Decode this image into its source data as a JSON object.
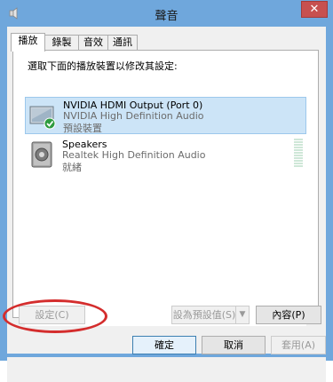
{
  "window": {
    "title": "聲音",
    "close_glyph": "✕"
  },
  "tabs": [
    {
      "label": "播放",
      "active": true
    },
    {
      "label": "錄製",
      "active": false
    },
    {
      "label": "音效",
      "active": false
    },
    {
      "label": "通訊",
      "active": false
    }
  ],
  "instruction": "選取下面的播放裝置以修改其設定:",
  "devices": [
    {
      "name": "NVIDIA HDMI Output (Port 0)",
      "driver": "NVIDIA High Definition Audio",
      "status": "預設裝置",
      "selected": true,
      "icon": "monitor-icon"
    },
    {
      "name": "Speakers",
      "driver": "Realtek High Definition Audio",
      "status": "就緒",
      "selected": false,
      "icon": "speaker-icon"
    }
  ],
  "buttons": {
    "configure": "設定(C)",
    "set_default": "設為預設值(S)",
    "properties": "內容(P)",
    "ok": "確定",
    "cancel": "取消",
    "apply": "套用(A)"
  },
  "colors": {
    "frame": "#6fa7dc",
    "close": "#c7504f",
    "selection": "#cce4f7",
    "annotation": "#d42d2d"
  }
}
